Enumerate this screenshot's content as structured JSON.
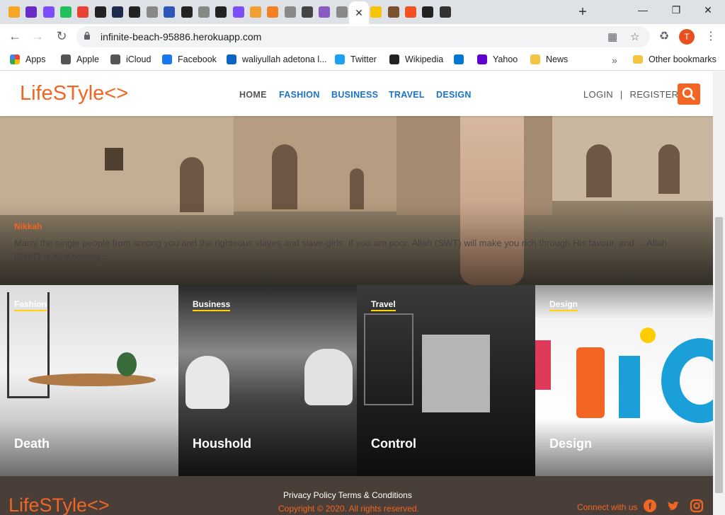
{
  "browser": {
    "tabs": [
      {
        "icon": "chart-bars-icon",
        "color": "#f5a623"
      },
      {
        "icon": "mail-icon",
        "color": "#6a2cc9"
      },
      {
        "icon": "m-logo-icon",
        "color": "#7b4dff"
      },
      {
        "icon": "p-logo-icon",
        "color": "#20c05c"
      },
      {
        "icon": "gmail-icon",
        "color": "#ea4335"
      },
      {
        "icon": "github-icon",
        "color": "#222222"
      },
      {
        "icon": "code-icon",
        "color": "#1b2b4b"
      },
      {
        "icon": "github-icon",
        "color": "#222222"
      },
      {
        "icon": "globe-icon",
        "color": "#888888"
      },
      {
        "icon": "building-icon",
        "color": "#2c57b7"
      },
      {
        "icon": "github-icon",
        "color": "#222222"
      },
      {
        "icon": "globe-icon",
        "color": "#888888"
      },
      {
        "icon": "github-icon",
        "color": "#222222"
      },
      {
        "icon": "m-logo-icon",
        "color": "#7b4dff"
      },
      {
        "icon": "pencil-icon",
        "color": "#f0a030"
      },
      {
        "icon": "stackoverflow-icon",
        "color": "#f48024"
      },
      {
        "icon": "globe-icon",
        "color": "#888888"
      },
      {
        "icon": "arch-icon",
        "color": "#444444"
      },
      {
        "icon": "h-logo-icon",
        "color": "#8a5cc2"
      },
      {
        "icon": "globe-icon",
        "color": "#888888"
      },
      {
        "icon": "close-icon",
        "color": "#333333",
        "active": true
      },
      {
        "icon": "mtn-icon",
        "color": "#f7c600"
      },
      {
        "icon": "box-icon",
        "color": "#7a5230"
      },
      {
        "icon": "windows-icon",
        "color": "#f25022"
      },
      {
        "icon": "github-icon",
        "color": "#222222"
      },
      {
        "icon": "x-box-icon",
        "color": "#333333"
      }
    ],
    "url": "infinite-beach-95886.herokuapp.com",
    "profile_initial": "T",
    "bookmarks": [
      {
        "label": "Apps",
        "icon": "apps-grid-icon",
        "color": "#ea4335"
      },
      {
        "label": "Apple",
        "icon": "apple-icon",
        "color": "#555555"
      },
      {
        "label": "iCloud",
        "icon": "apple-icon",
        "color": "#555555"
      },
      {
        "label": "Facebook",
        "icon": "facebook-icon",
        "color": "#1877f2"
      },
      {
        "label": "waliyullah adetona l...",
        "icon": "linkedin-icon",
        "color": "#0a66c2"
      },
      {
        "label": "Twitter",
        "icon": "twitter-icon",
        "color": "#1da1f2"
      },
      {
        "label": "Wikipedia",
        "icon": "wikipedia-icon",
        "color": "#222222"
      },
      {
        "label": "",
        "icon": "azure-icon",
        "color": "#0078d4"
      },
      {
        "label": "Yahoo",
        "icon": "yahoo-icon",
        "color": "#6001d2"
      },
      {
        "label": "News",
        "icon": "folder-icon",
        "color": "#f5c542"
      }
    ],
    "other_bookmarks": "Other bookmarks",
    "overflow": "»"
  },
  "site": {
    "logo": "LifeSTyle<>",
    "nav": [
      {
        "label": "HOME",
        "color": "#555555"
      },
      {
        "label": "FASHION",
        "color": "#1a73c8"
      },
      {
        "label": "BUSINESS",
        "color": "#1a73c8"
      },
      {
        "label": "TRAVEL",
        "color": "#1a73c8"
      },
      {
        "label": "DESIGN",
        "color": "#1a73c8"
      }
    ],
    "login": "LOGIN",
    "separator": "|",
    "register": "REGISTER",
    "accent": "#f26522"
  },
  "hero": {
    "tag": "Nikkah",
    "text": "Marry the single people from among you and the righteous slaves and slave-girls. If you are poor, Allah (SWT) will make you rich through His favour, and ... Allah (SWT) is All-Knowing..."
  },
  "cards": [
    {
      "category": "Fashion",
      "title": "Death"
    },
    {
      "category": "Business",
      "title": "Houshold"
    },
    {
      "category": "Travel",
      "title": "Control"
    },
    {
      "category": "Design",
      "title": "Design"
    }
  ],
  "footer": {
    "logo": "LifeSTyle<>",
    "links": "Privacy Policy Terms & Conditions",
    "copyright": "Copyright © 2020. All rights reserved.",
    "connect": "Connect with us",
    "social": [
      "facebook-icon",
      "twitter-icon",
      "instagram-icon"
    ]
  }
}
